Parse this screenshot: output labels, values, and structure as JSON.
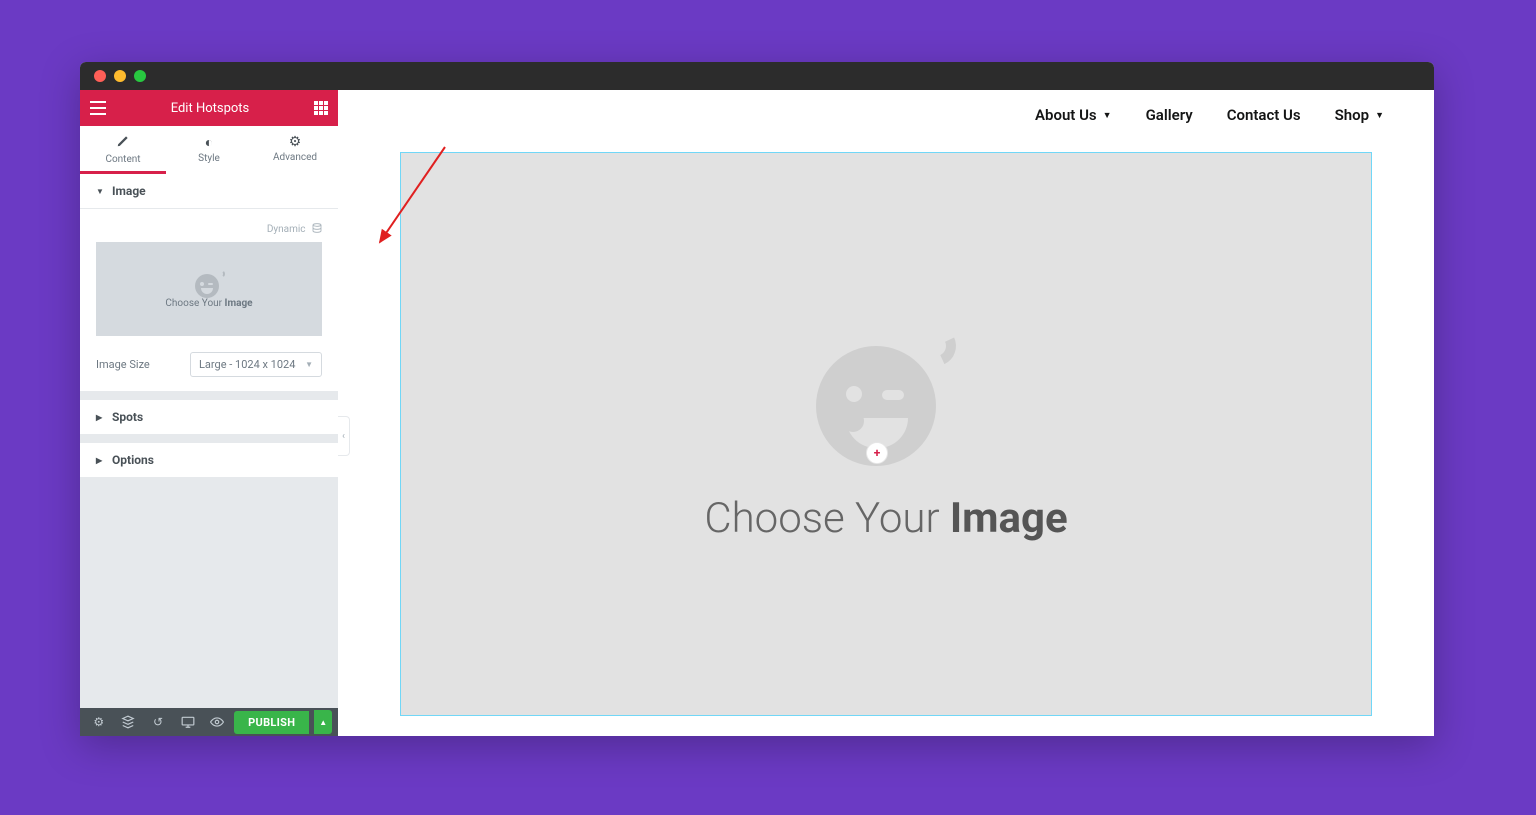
{
  "sidebar": {
    "title": "Edit Hotspots",
    "tabs": {
      "content": "Content",
      "style": "Style",
      "advanced": "Advanced"
    },
    "sections": {
      "image": {
        "label": "Image",
        "dynamic": "Dynamic",
        "choose_prefix": "Choose Your ",
        "choose_bold": "Image",
        "size_label": "Image Size",
        "size_value": "Large - 1024 x 1024"
      },
      "spots": {
        "label": "Spots"
      },
      "options": {
        "label": "Options"
      }
    }
  },
  "footer": {
    "publish": "PUBLISH"
  },
  "nav": {
    "about": "About Us",
    "gallery": "Gallery",
    "contact": "Contact Us",
    "shop": "Shop"
  },
  "canvas": {
    "choose_prefix": "Choose Your ",
    "choose_bold": "Image",
    "plus": "+"
  }
}
